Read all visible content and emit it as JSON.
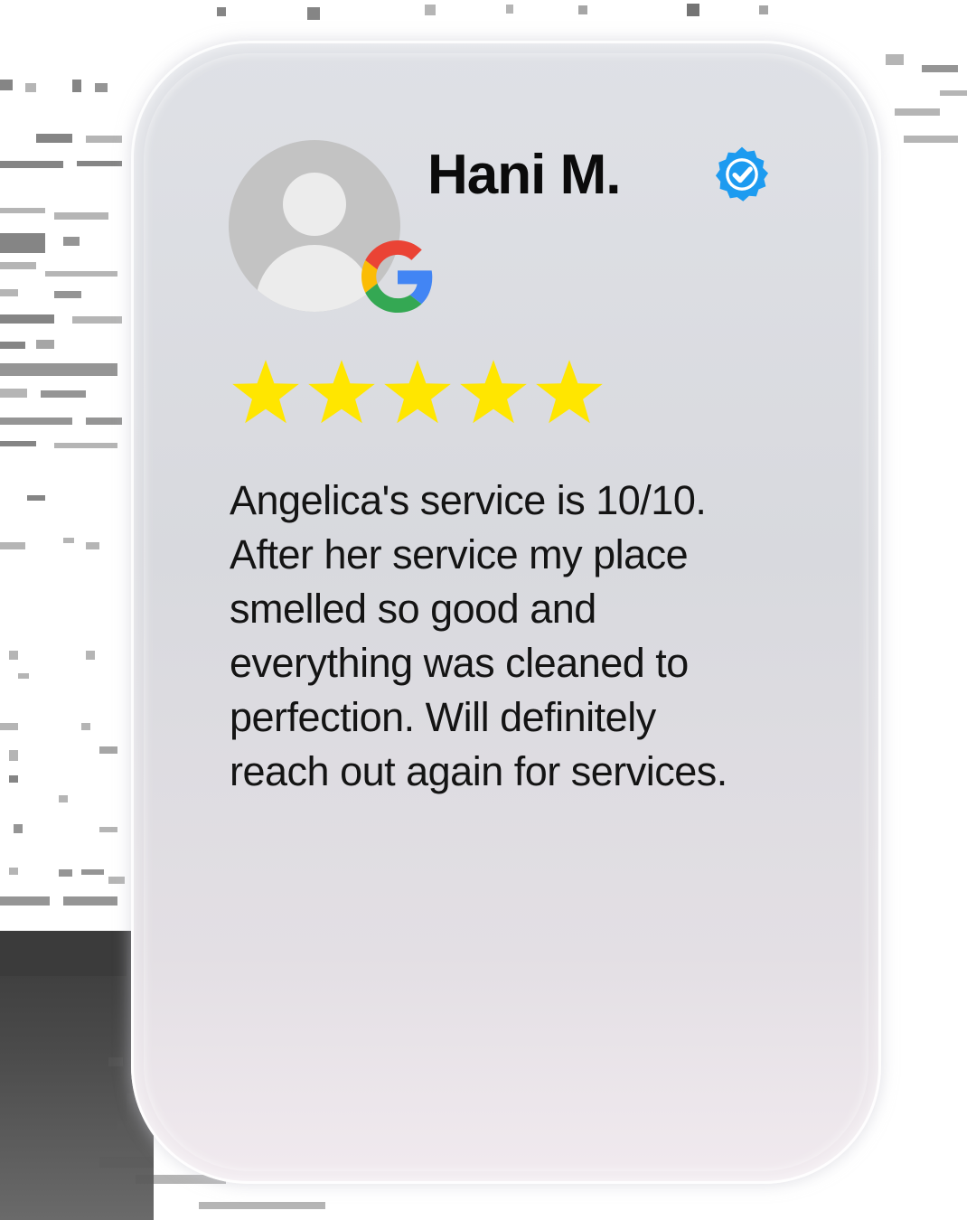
{
  "review": {
    "reviewer_name": "Hani M.",
    "rating": 5,
    "rating_max": 5,
    "source_icon": "google-g-icon",
    "verified_icon": "verified-badge-icon",
    "text": "Angelica's service is 10/10.\nAfter her service my place\nsmelled so good and\neverything was cleaned to\nperfection. Will definitely\nreach out again for services."
  },
  "colors": {
    "star": "#FFE600",
    "verified_badge": "#1D9BF0",
    "card_bg": "#DCDDE2",
    "name_text": "#0B0B0B"
  }
}
